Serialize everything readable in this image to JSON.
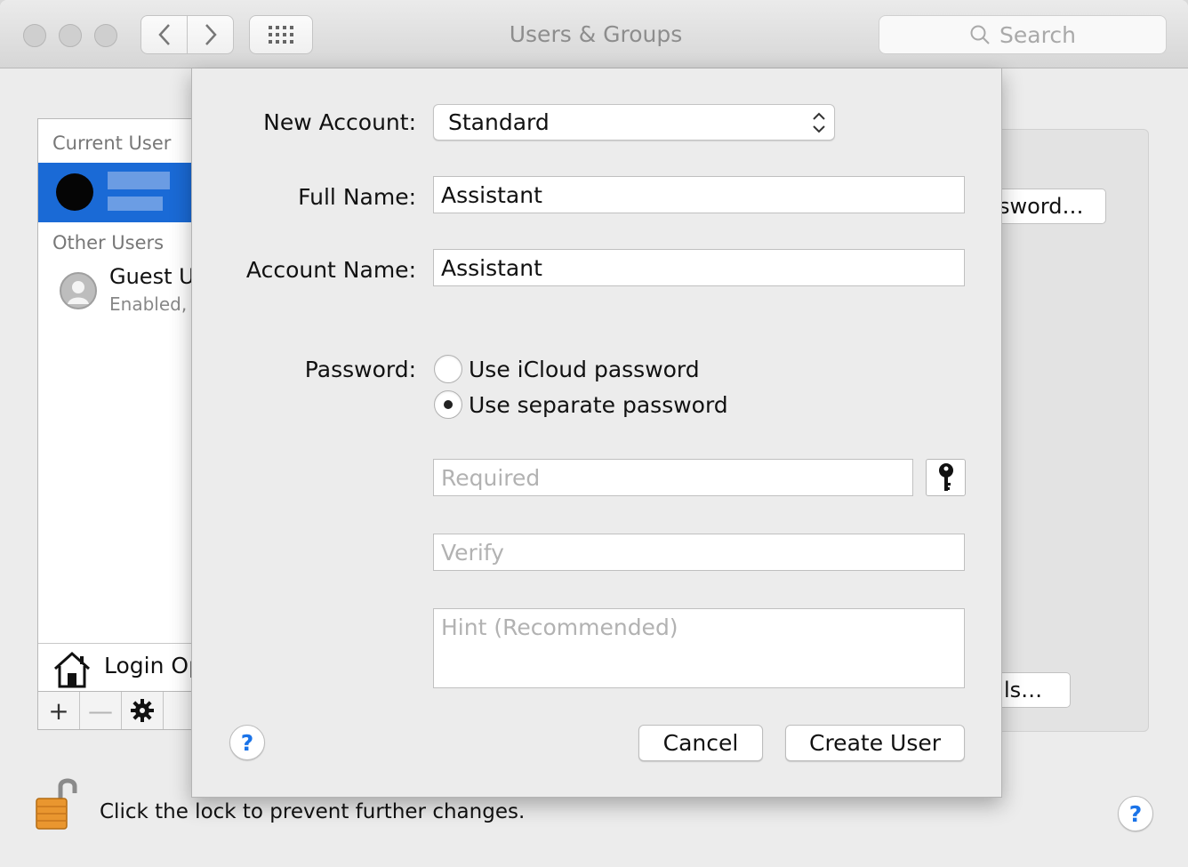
{
  "window": {
    "title": "Users & Groups",
    "search_placeholder": "Search"
  },
  "toolbar": {
    "back_icon": "chevron-left-icon",
    "forward_icon": "chevron-right-icon",
    "grid_icon": "grid-icon"
  },
  "sidebar": {
    "current_user_heading": "Current User",
    "other_users_heading": "Other Users",
    "guest_name": "Guest U",
    "guest_status": "Enabled,",
    "login_options_label": "Login Op",
    "add_label": "+",
    "remove_label": "—"
  },
  "background_buttons": {
    "password_button": "sword…",
    "controls_button": "ls…"
  },
  "footer": {
    "lock_text": "Click the lock to prevent further changes.",
    "help_label": "?"
  },
  "sheet": {
    "new_account_label": "New Account:",
    "account_type": "Standard",
    "full_name_label": "Full Name:",
    "full_name_value": "Assistant",
    "account_name_label": "Account Name:",
    "account_name_value": "Assistant",
    "password_label": "Password:",
    "radio_icloud": "Use iCloud password",
    "radio_separate": "Use separate password",
    "password_placeholder": "Required",
    "verify_placeholder": "Verify",
    "hint_placeholder": "Hint (Recommended)",
    "help_label": "?",
    "cancel_label": "Cancel",
    "create_label": "Create User"
  }
}
